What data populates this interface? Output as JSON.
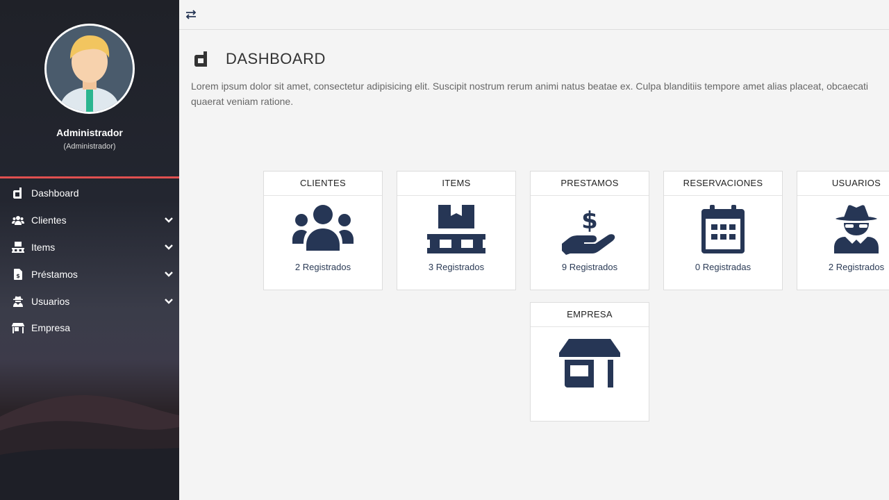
{
  "profile": {
    "name": "Administrador",
    "role": "(Administrador)"
  },
  "menu": [
    {
      "label": "Dashboard",
      "icon": "dashboard-icon",
      "has_submenu": false
    },
    {
      "label": "Clientes",
      "icon": "users-icon",
      "has_submenu": true
    },
    {
      "label": "Items",
      "icon": "pallet-icon",
      "has_submenu": true
    },
    {
      "label": "Préstamos",
      "icon": "invoice-icon",
      "has_submenu": true
    },
    {
      "label": "Usuarios",
      "icon": "user-secret-icon",
      "has_submenu": true
    },
    {
      "label": "Empresa",
      "icon": "store-icon",
      "has_submenu": false
    }
  ],
  "header": {
    "title": "DASHBOARD",
    "description": "Lorem ipsum dolor sit amet, consectetur adipisicing elit. Suscipit nostrum rerum animi natus beatae ex. Culpa blanditiis tempore amet alias placeat, obcaecati quaerat veniam ratione."
  },
  "tiles": [
    {
      "title": "CLIENTES",
      "count": "2 Registrados",
      "icon": "users-icon"
    },
    {
      "title": "ITEMS",
      "count": "3 Registrados",
      "icon": "pallet-icon"
    },
    {
      "title": "PRESTAMOS",
      "count": "9 Registrados",
      "icon": "hand-holding-dollar-icon"
    },
    {
      "title": "RESERVACIONES",
      "count": "0 Registradas",
      "icon": "calendar-icon"
    },
    {
      "title": "USUARIOS",
      "count": "2 Registrados",
      "icon": "user-secret-icon"
    },
    {
      "title": "EMPRESA",
      "count": "",
      "icon": "store-icon"
    }
  ],
  "colors": {
    "sidebar_bg": "#1f2128",
    "accent_divider": "#e05050",
    "icon_navy": "#263655",
    "page_bg": "#f4f4f4"
  }
}
